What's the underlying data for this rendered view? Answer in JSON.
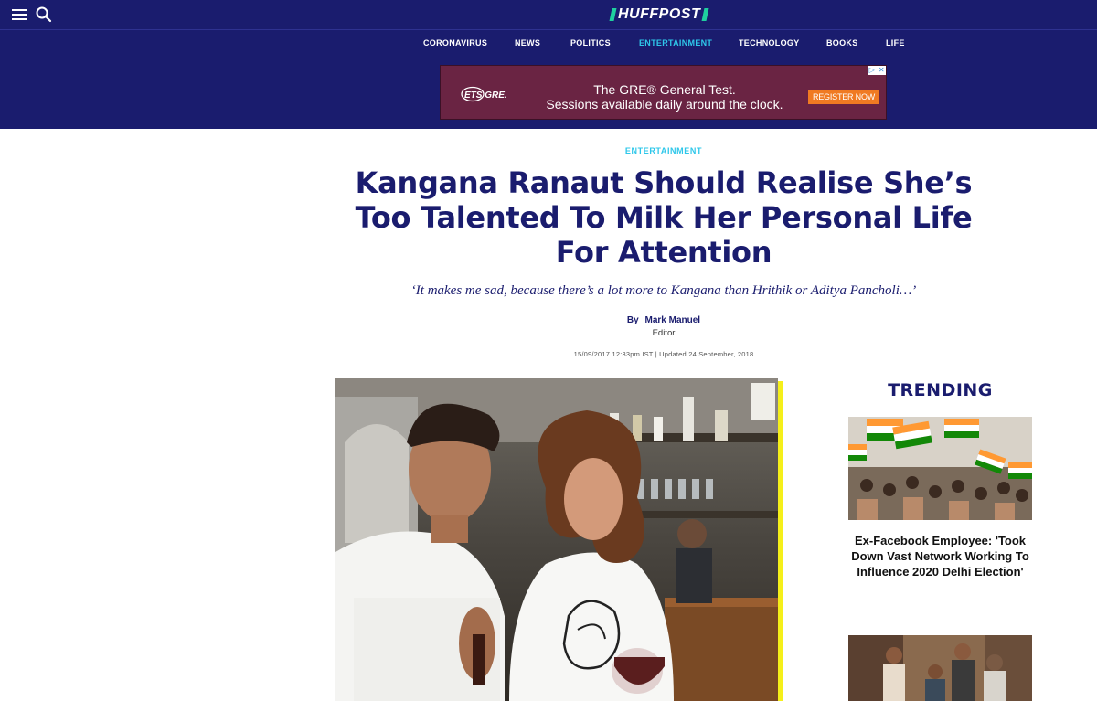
{
  "header": {
    "logo_text": "HUFFPOST",
    "menu_icon": "hamburger-menu-icon",
    "search_icon": "search-icon"
  },
  "nav": {
    "items": [
      "CORONAVIRUS",
      "NEWS",
      "POLITICS",
      "ENTERTAINMENT",
      "TECHNOLOGY",
      "BOOKS",
      "LIFE"
    ],
    "active": "ENTERTAINMENT"
  },
  "ad": {
    "brand": "ETS GRE.",
    "line1": "The GRE® General Test.",
    "line2": "Sessions available daily around the clock.",
    "cta": "REGISTER NOW",
    "close_glyphs": [
      "▷",
      "✕"
    ]
  },
  "article": {
    "section": "ENTERTAINMENT",
    "headline": "Kangana Ranaut Should Realise She’s Too Talented To Milk Her Personal Life For Attention",
    "dek": "‘It makes me sad, because there’s a lot more to Kangana than Hrithik or Aditya Pancholi…’",
    "byline_prefix": "By",
    "author": "Mark Manuel",
    "author_role": "Editor",
    "timestamp": "15/09/2017 12:33pm IST | Updated 24 September, 2018"
  },
  "sidebar": {
    "title": "TRENDING",
    "stories": [
      {
        "headline": "Ex-Facebook Employee: 'Took Down Vast Network Working To Influence 2020 Delhi Election'"
      }
    ]
  },
  "colors": {
    "brand_navy": "#1a1c6e",
    "accent_cyan": "#2ec7ea",
    "logo_green": "#1fcf9f",
    "ad_maroon": "#6a2443",
    "ad_cta_orange": "#f07a22",
    "rule_yellow": "#f5ef1a"
  }
}
